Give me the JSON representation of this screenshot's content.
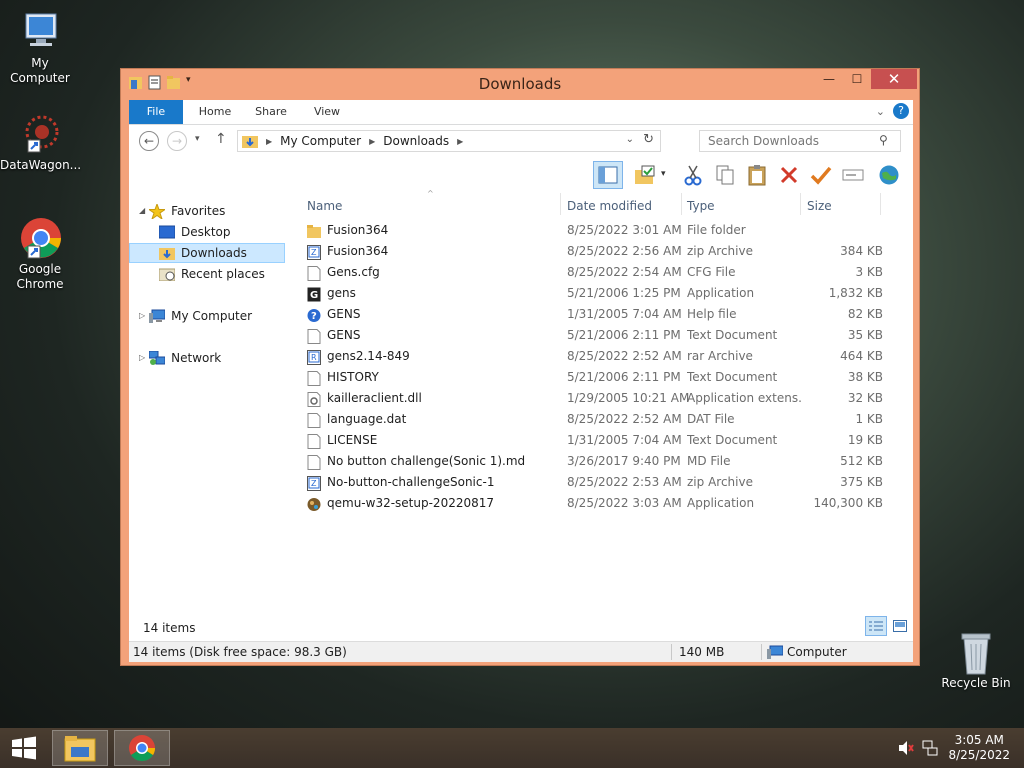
{
  "desktop": {
    "icons": [
      {
        "label": "My Computer"
      },
      {
        "label": "DataWagon..."
      },
      {
        "label": "Google Chrome"
      },
      {
        "label": "Recycle Bin"
      }
    ]
  },
  "window": {
    "title": "Downloads",
    "controls": {
      "minimize": "—",
      "maximize": "☐",
      "close": "✕"
    },
    "ribbon_tabs": [
      "File",
      "Home",
      "Share",
      "View"
    ],
    "address": {
      "crumbs": [
        "My Computer",
        "Downloads"
      ],
      "search_placeholder": "Search Downloads"
    }
  },
  "nav": {
    "favorites": "Favorites",
    "desktop": "Desktop",
    "downloads": "Downloads",
    "recent": "Recent places",
    "computer": "My Computer",
    "network": "Network"
  },
  "columns": {
    "name": "Name",
    "date": "Date modified",
    "type": "Type",
    "size": "Size"
  },
  "files": [
    {
      "name": "Fusion364",
      "date": "8/25/2022 3:01 AM",
      "type": "File folder",
      "size": "",
      "icon": "folder"
    },
    {
      "name": "Fusion364",
      "date": "8/25/2022 2:56 AM",
      "type": "zip Archive",
      "size": "384 KB",
      "icon": "zip"
    },
    {
      "name": "Gens.cfg",
      "date": "8/25/2022 2:54 AM",
      "type": "CFG File",
      "size": "3 KB",
      "icon": "doc"
    },
    {
      "name": "gens",
      "date": "5/21/2006 1:25 PM",
      "type": "Application",
      "size": "1,832 KB",
      "icon": "app"
    },
    {
      "name": "GENS",
      "date": "1/31/2005 7:04 AM",
      "type": "Help file",
      "size": "82 KB",
      "icon": "help"
    },
    {
      "name": "GENS",
      "date": "5/21/2006 2:11 PM",
      "type": "Text Document",
      "size": "35 KB",
      "icon": "doc"
    },
    {
      "name": "gens2.14-849",
      "date": "8/25/2022 2:52 AM",
      "type": "rar Archive",
      "size": "464 KB",
      "icon": "rar"
    },
    {
      "name": "HISTORY",
      "date": "5/21/2006 2:11 PM",
      "type": "Text Document",
      "size": "38 KB",
      "icon": "doc"
    },
    {
      "name": "kailleraclient.dll",
      "date": "1/29/2005 10:21 AM",
      "type": "Application extens...",
      "size": "32 KB",
      "icon": "dll"
    },
    {
      "name": "language.dat",
      "date": "8/25/2022 2:52 AM",
      "type": "DAT File",
      "size": "1 KB",
      "icon": "doc"
    },
    {
      "name": "LICENSE",
      "date": "1/31/2005 7:04 AM",
      "type": "Text Document",
      "size": "19 KB",
      "icon": "doc"
    },
    {
      "name": "No button challenge(Sonic 1).md",
      "date": "3/26/2017 9:40 PM",
      "type": "MD File",
      "size": "512 KB",
      "icon": "doc"
    },
    {
      "name": "No-button-challengeSonic-1",
      "date": "8/25/2022 2:53 AM",
      "type": "zip Archive",
      "size": "375 KB",
      "icon": "zip"
    },
    {
      "name": "qemu-w32-setup-20220817",
      "date": "8/25/2022 3:03 AM",
      "type": "Application",
      "size": "140,300 KB",
      "icon": "qemu"
    }
  ],
  "item_count": "14 items",
  "status": {
    "left": "14 items (Disk free space: 98.3 GB)",
    "size": "140 MB",
    "location": "Computer"
  },
  "clock": {
    "time": "3:05 AM",
    "date": "8/25/2022"
  }
}
